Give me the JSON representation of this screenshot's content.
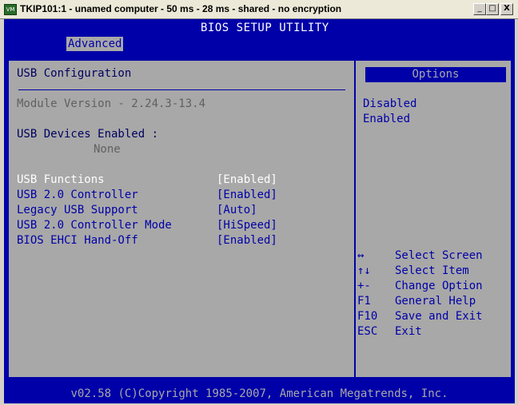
{
  "window": {
    "icon_label": "VM",
    "title": "TKIP101:1 - unamed computer - 50 ms - 28 ms - shared - no encryption",
    "buttons": {
      "minimize": "_",
      "maximize": "□",
      "close": "X"
    }
  },
  "bios": {
    "title": "BIOS SETUP UTILITY",
    "tab": "Advanced"
  },
  "left": {
    "section_title": "USB Configuration",
    "module_version": "Module Version - 2.24.3-13.4",
    "devices_label": "USB Devices Enabled :",
    "devices_value": "None",
    "settings": [
      {
        "label": "USB Functions",
        "value": "[Enabled]"
      },
      {
        "label": "USB 2.0 Controller",
        "value": "[Enabled]"
      },
      {
        "label": "Legacy USB Support",
        "value": "[Auto]"
      },
      {
        "label": "USB 2.0 Controller Mode",
        "value": "[HiSpeed]"
      },
      {
        "label": "BIOS EHCI Hand-Off",
        "value": "[Enabled]"
      }
    ]
  },
  "right": {
    "options_title": "Options",
    "options": [
      "Disabled",
      "Enabled"
    ],
    "help": [
      {
        "key": "↔",
        "action": "Select Screen"
      },
      {
        "key": "↑↓",
        "action": "Select Item"
      },
      {
        "key": "+-",
        "action": "Change Option"
      },
      {
        "key": "F1",
        "action": "General Help"
      },
      {
        "key": "F10",
        "action": "Save and Exit"
      },
      {
        "key": "ESC",
        "action": "Exit"
      }
    ]
  },
  "footer": "v02.58 (C)Copyright 1985-2007, American Megatrends, Inc.",
  "colors": {
    "bios_blue": "#0000a8",
    "bios_gray": "#a8a8a8",
    "highlight_white": "#ffffff"
  }
}
